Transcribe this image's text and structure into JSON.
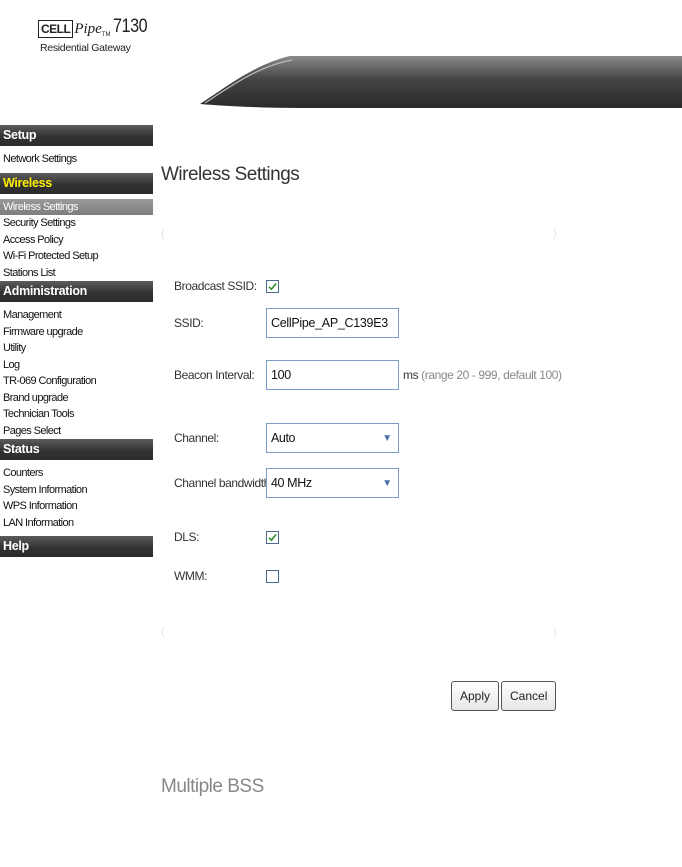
{
  "logo": {
    "brand": "CELL",
    "brand_pipe": "Pipe",
    "tm": "TM",
    "model": "7130",
    "tagline": "Residential Gateway"
  },
  "sidebar": {
    "sections": [
      {
        "title": "Setup",
        "active": false,
        "items": [
          "Network Settings"
        ]
      },
      {
        "title": "Wireless",
        "active": true,
        "items": [
          "Wireless Settings",
          "Security Settings",
          "Access Policy",
          "Wi-Fi Protected Setup",
          "Stations List"
        ],
        "selected_index": 0
      },
      {
        "title": "Administration",
        "active": false,
        "items": [
          "Management",
          "Firmware upgrade",
          "Utility",
          "Log",
          "TR-069 Configuration",
          "Brand upgrade",
          "Technician Tools",
          "Pages Select"
        ]
      },
      {
        "title": "Status",
        "active": false,
        "items": [
          "Counters",
          "System Information",
          "WPS Information",
          "LAN Information"
        ]
      },
      {
        "title": "Help",
        "active": false,
        "items": []
      }
    ]
  },
  "main": {
    "title": "Wireless Settings",
    "form": {
      "broadcast_ssid": {
        "label": "Broadcast SSID:",
        "checked": true
      },
      "ssid": {
        "label": "SSID:",
        "value": "CellPipe_AP_C139E3"
      },
      "beacon_interval": {
        "label": "Beacon Interval:",
        "value": "100",
        "unit": "ms",
        "hint": "(range 20 - 999, default 100)"
      },
      "channel": {
        "label": "Channel:",
        "value": "Auto"
      },
      "channel_bandwidth": {
        "label": "Channel bandwidth:",
        "value": "40 MHz"
      },
      "dls": {
        "label": "DLS:",
        "checked": true
      },
      "wmm": {
        "label": "WMM:",
        "checked": false
      }
    },
    "buttons": {
      "apply": "Apply",
      "cancel": "Cancel"
    },
    "multiple_bss_title": "Multiple BSS"
  },
  "colors": {
    "nav_header": "#333333",
    "active_header_text": "#ffee00",
    "selected_item_bg": "#8a8a8a",
    "input_border": "#7a9cc6",
    "check_color": "#2e8b2e"
  }
}
